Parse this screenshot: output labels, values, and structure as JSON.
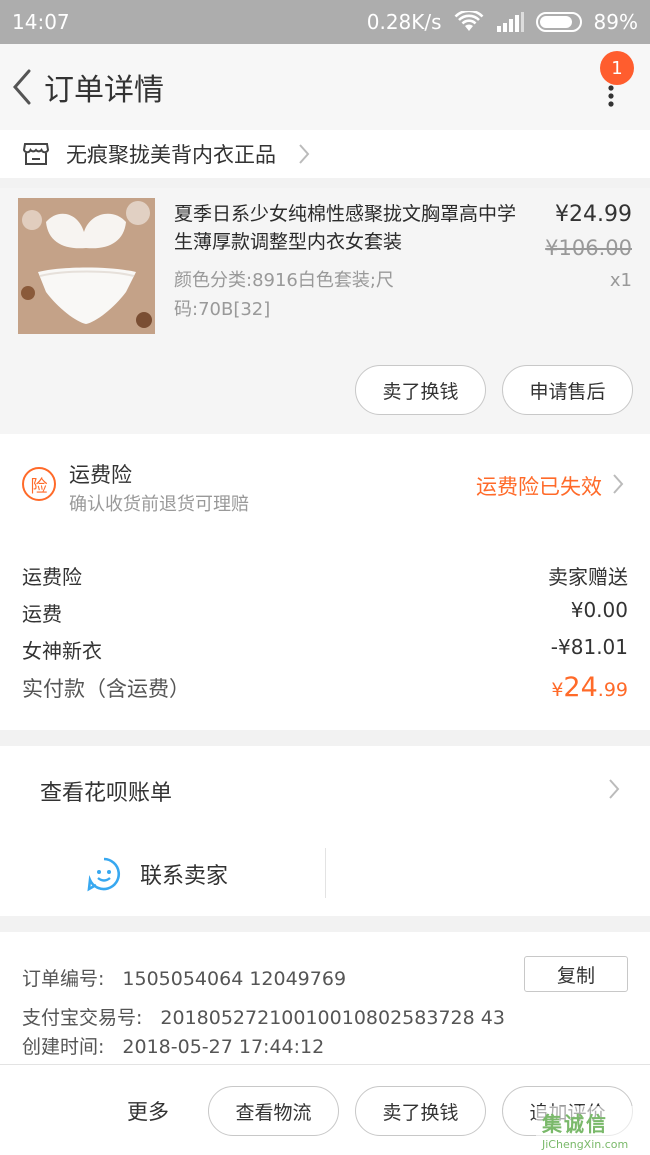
{
  "status_bar": {
    "time": "14:07",
    "speed": "0.28K/s",
    "battery": "89%"
  },
  "nav": {
    "title": "订单详情",
    "badge_count": "1"
  },
  "shop": {
    "name": "无痕聚拢美背内衣正品"
  },
  "product": {
    "title": "夏季日系少女纯棉性感聚拢文胸罩高中学生薄厚款调整型内衣女套装",
    "spec": "颜色分类:8916白色套装;尺码:70B[32]",
    "price": "¥24.99",
    "original_price": "¥106.00",
    "quantity": "x1",
    "buttons": {
      "sell": "卖了换钱",
      "after_sale": "申请售后"
    }
  },
  "insurance": {
    "icon_char": "险",
    "title": "运费险",
    "desc": "确认收货前退货可理赔",
    "status": "运费险已失效"
  },
  "costs": [
    {
      "label": "运费险",
      "value": "卖家赠送"
    },
    {
      "label": "运费",
      "value": "¥0.00"
    },
    {
      "label": "女神新衣",
      "value": "-¥81.01"
    }
  ],
  "total": {
    "label": "实付款（含运费）",
    "currency": "¥",
    "integer": "24",
    "decimal": ".99"
  },
  "huabei": {
    "label": "查看花呗账单"
  },
  "contact": {
    "label": "联系卖家"
  },
  "order_info": {
    "order_no_label": "订单编号:",
    "order_no": "1505054064 12049769",
    "alipay_label": "支付宝交易号:",
    "alipay_no": "20180527210010010802583728 43",
    "created_label": "创建时间:",
    "created": "2018-05-27 17:44:12",
    "copy_label": "复制"
  },
  "bottom_bar": {
    "more": "更多",
    "logistics": "查看物流",
    "sell": "卖了换钱",
    "review": "追加评价"
  },
  "watermark": {
    "text": "集诚信",
    "url": "JiChengXin.com"
  },
  "colors": {
    "accent": "#ff6a29",
    "badge": "#ff5d2e"
  }
}
